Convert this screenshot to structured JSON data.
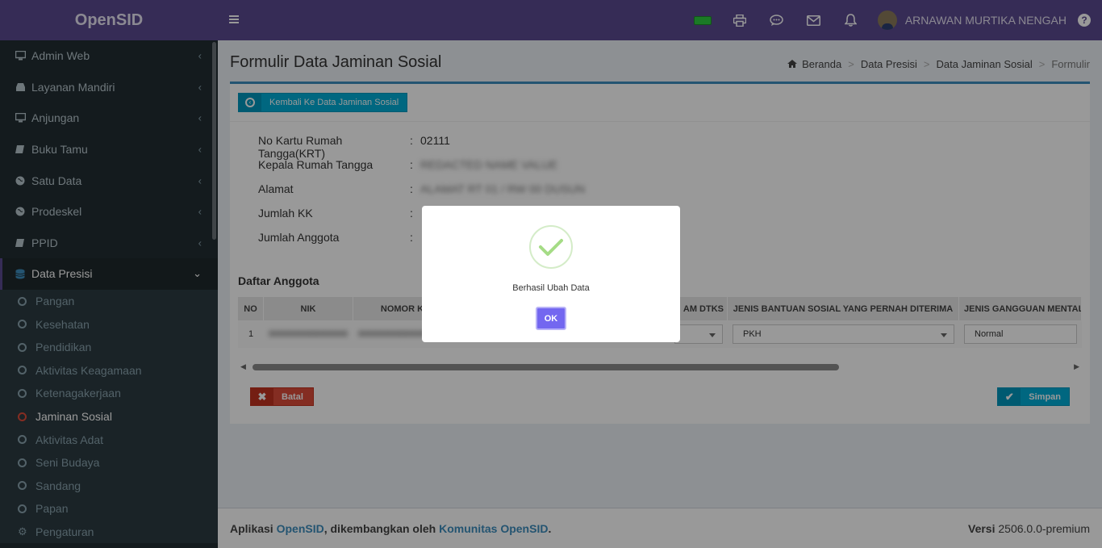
{
  "brand": "OpenSID",
  "sidebar": {
    "menu": [
      {
        "label": "Admin Web",
        "icon": "monitor-icon"
      },
      {
        "label": "Layanan Mandiri",
        "icon": "inbox-icon"
      },
      {
        "label": "Anjungan",
        "icon": "monitor-icon"
      },
      {
        "label": "Buku Tamu",
        "icon": "book-icon"
      },
      {
        "label": "Satu Data",
        "icon": "globe-icon"
      },
      {
        "label": "Prodeskel",
        "icon": "globe-icon"
      },
      {
        "label": "PPID",
        "icon": "book-icon"
      },
      {
        "label": "Data Presisi",
        "icon": "database-icon"
      }
    ],
    "submenu": [
      "Pangan",
      "Kesehatan",
      "Pendidikan",
      "Aktivitas Keagamaan",
      "Ketenagakerjaan",
      "Jaminan Sosial",
      "Aktivitas Adat",
      "Seni Budaya",
      "Sandang",
      "Papan",
      "Pengaturan"
    ]
  },
  "topbar": {
    "user_name": "ARNAWAN MURTIKA NENGAH",
    "help": "?"
  },
  "header": {
    "title": "Formulir Data Jaminan Sosial",
    "breadcrumb": [
      "Beranda",
      "Data Presisi",
      "Data Jaminan Sosial",
      "Formulir"
    ],
    "sep": ">"
  },
  "box": {
    "back_label": "Kembali Ke Data Jaminan Sosial",
    "info": {
      "krt_label": "No Kartu Rumah Tangga(KRT)",
      "krt_value": "02111",
      "kepala_label": "Kepala Rumah Tangga",
      "kepala_value": "REDACTED NAME VALUE",
      "alamat_label": "Alamat",
      "alamat_value": "ALAMAT RT 01 / RW 00 DUSUN",
      "jumlah_kk_label": "Jumlah KK",
      "jumlah_anggota_label": "Jumlah Anggota",
      "colon": ":"
    },
    "section_title": "Daftar Anggota",
    "table": {
      "headers": [
        "NO",
        "NIK",
        "NOMOR KK",
        "AM DTKS",
        "JENIS BANTUAN SOSIAL YANG PERNAH DITERIMA",
        "JENIS GANGGUAN MENTAL"
      ],
      "row": {
        "no": "1",
        "nik": "0000000000000000",
        "kk": "0000000000000000",
        "bantuan": "PKH",
        "gangguan": "Normal"
      }
    },
    "batal_label": "Batal",
    "simpan_label": "Simpan"
  },
  "footer": {
    "prefix": "Aplikasi",
    "app_link": "OpenSID",
    "middle": ", dikembangkan oleh",
    "community_link": "Komunitas OpenSID",
    "suffix": ".",
    "version_label": "Versi",
    "version_value": "2506.0.0-premium"
  },
  "modal": {
    "message": "Berhasil Ubah Data",
    "ok_label": "OK",
    "success_color": "#a5dc86",
    "button_color": "#7367f0"
  }
}
